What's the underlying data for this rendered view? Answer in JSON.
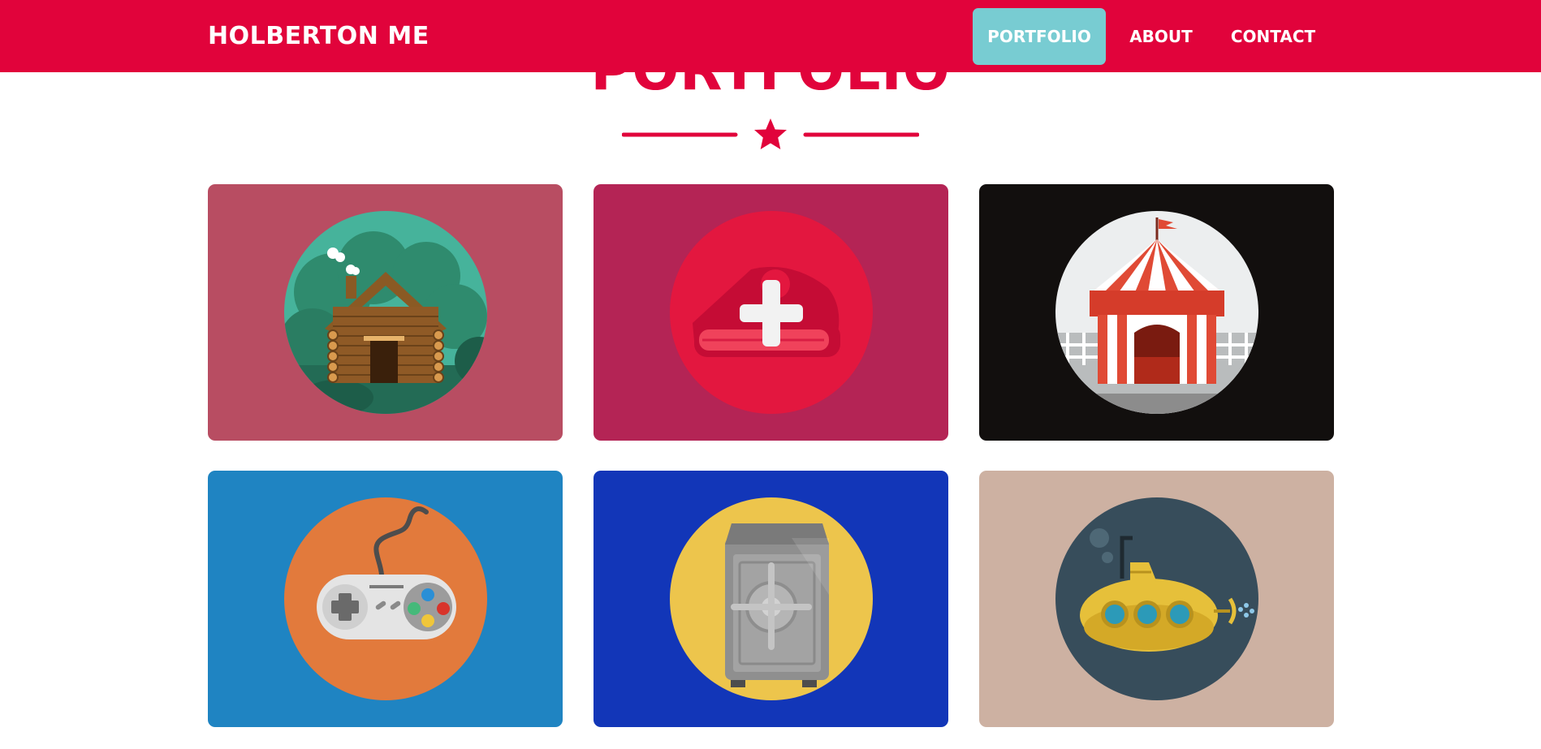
{
  "navbar": {
    "brand": "HOLBERTON ME",
    "items": [
      {
        "label": "PORTFOLIO",
        "active": true
      },
      {
        "label": "ABOUT",
        "active": false
      },
      {
        "label": "CONTACT",
        "active": false
      }
    ],
    "colors": {
      "background": "#e1033b",
      "active_background": "#78ccd2",
      "text": "#ffffff"
    }
  },
  "section": {
    "title": "PORTFOLIO",
    "divider_icon": "star-icon",
    "accent_color": "#e1033b"
  },
  "portfolio": {
    "items": [
      {
        "icon": "log-cabin-icon",
        "card_color": "#b84d62",
        "circle_color": "#46b39b"
      },
      {
        "icon": "medical-cake-icon",
        "card_color": "#b42455",
        "circle_color": "#e3173f"
      },
      {
        "icon": "circus-tent-icon",
        "card_color": "#120f0e",
        "circle_color": "#eceeef"
      },
      {
        "icon": "game-controller-icon",
        "card_color": "#1f84c2",
        "circle_color": "#e27a3c"
      },
      {
        "icon": "safe-icon",
        "card_color": "#1236b8",
        "circle_color": "#edc54c"
      },
      {
        "icon": "submarine-icon",
        "card_color": "#cdb1a2",
        "circle_color": "#374d5b"
      }
    ]
  }
}
